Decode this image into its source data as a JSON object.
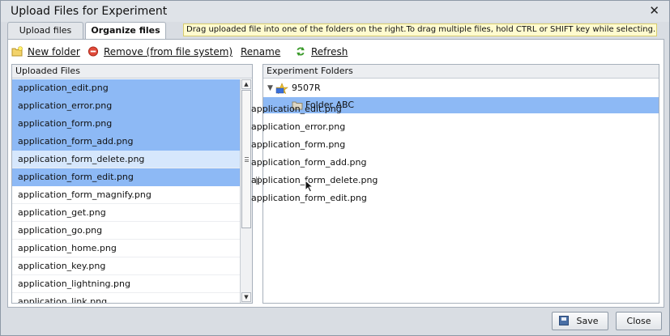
{
  "dialog": {
    "title": "Upload Files for Experiment",
    "close_symbol": "✕"
  },
  "tabs": [
    {
      "label": "Upload files",
      "active": false
    },
    {
      "label": "Organize files",
      "active": true
    }
  ],
  "hint": "Drag uploaded file into one of the folders on the right.To drag multiple files, hold CTRL or SHIFT key while selecting.",
  "toolbar": {
    "new_folder": "New folder",
    "remove": "Remove (from file system)",
    "rename": "Rename",
    "refresh": "Refresh"
  },
  "uploaded_files": {
    "header": "Uploaded Files",
    "items": [
      {
        "name": "application_edit.png",
        "state": "selected"
      },
      {
        "name": "application_error.png",
        "state": "selected"
      },
      {
        "name": "application_form.png",
        "state": "selected"
      },
      {
        "name": "application_form_add.png",
        "state": "selected"
      },
      {
        "name": "application_form_delete.png",
        "state": "hover"
      },
      {
        "name": "application_form_edit.png",
        "state": "selected"
      },
      {
        "name": "application_form_magnify.png",
        "state": "normal"
      },
      {
        "name": "application_get.png",
        "state": "normal"
      },
      {
        "name": "application_go.png",
        "state": "normal"
      },
      {
        "name": "application_home.png",
        "state": "normal"
      },
      {
        "name": "application_key.png",
        "state": "normal"
      },
      {
        "name": "application_lightning.png",
        "state": "normal"
      },
      {
        "name": "application_link.png",
        "state": "normal"
      }
    ],
    "scroll_up": "▲",
    "scroll_down": "▼"
  },
  "experiment_folders": {
    "header": "Experiment Folders",
    "root": {
      "label": "9507R",
      "expanded": true
    },
    "children": [
      {
        "label": "Folder ABC",
        "selected": true
      }
    ]
  },
  "drag_preview": [
    "application_edit.png",
    "application_error.png",
    "application_form.png",
    "application_form_add.png",
    "application_form_delete.png",
    "application_form_edit.png"
  ],
  "footer": {
    "save": "Save",
    "close": "Close"
  },
  "colors": {
    "selection": "#8db9f5",
    "hover": "#d6e7fc",
    "hint_bg": "#fffbcf"
  }
}
